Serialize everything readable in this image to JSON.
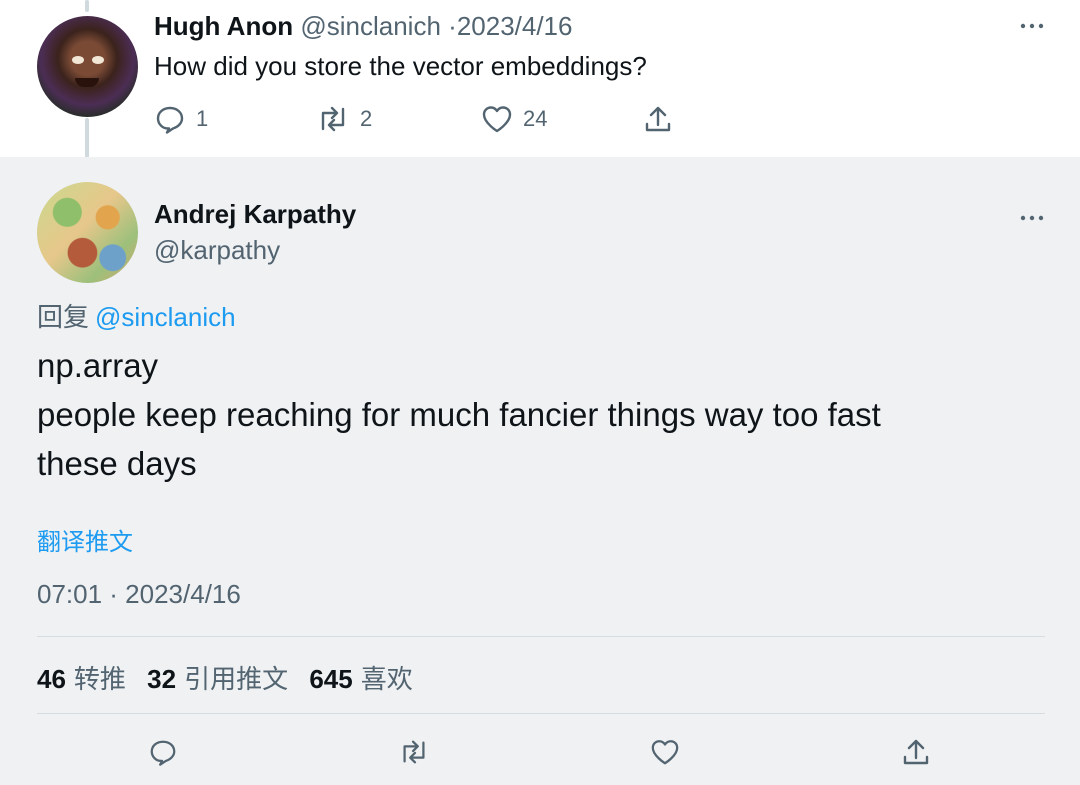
{
  "parent_tweet": {
    "author_name": "Hugh Anon",
    "handle": "@sinclanich",
    "separator": "·",
    "date": "2023/4/16",
    "text": "How did you store the vector embeddings?",
    "actions": {
      "reply_count": "1",
      "retweet_count": "2",
      "like_count": "24"
    },
    "more_icon": "more-horizontal-icon"
  },
  "main_tweet": {
    "author_name": "Andrej Karpathy",
    "handle": "@karpathy",
    "reply_prefix": "回复",
    "reply_mention": "@sinclanich",
    "body_lines": [
      "np.array",
      "people keep reaching for much fancier things way too fast",
      "these days"
    ],
    "translate_label": "翻译推文",
    "timestamp": "07:01 · 2023/4/16",
    "stats": {
      "retweets": "46",
      "retweets_label": "转推",
      "quotes": "32",
      "quotes_label": "引用推文",
      "likes": "645",
      "likes_label": "喜欢"
    }
  },
  "colors": {
    "accent": "#1d9bf0",
    "muted_text": "#536471",
    "main_bg": "#eff1f3",
    "divider": "#d6dce0"
  }
}
